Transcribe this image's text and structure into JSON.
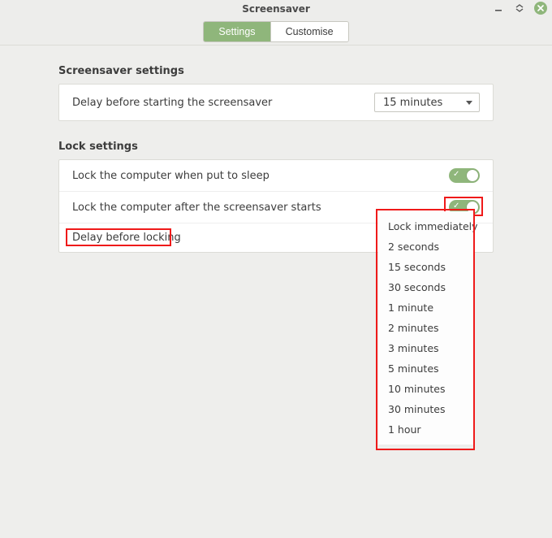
{
  "window": {
    "title": "Screensaver"
  },
  "tabs": {
    "settings": "Settings",
    "customise": "Customise"
  },
  "sections": {
    "screensaver": {
      "title": "Screensaver settings",
      "rows": {
        "delay_start": {
          "label": "Delay before starting the screensaver",
          "value": "15 minutes"
        }
      }
    },
    "lock": {
      "title": "Lock settings",
      "rows": {
        "lock_sleep": {
          "label": "Lock the computer when put to sleep",
          "on": true
        },
        "lock_after_ss": {
          "label": "Lock the computer after the screensaver starts",
          "on": true
        },
        "delay_lock": {
          "label": "Delay before locking"
        }
      }
    }
  },
  "delay_menu": {
    "items": [
      "Lock immediately",
      "2 seconds",
      "15 seconds",
      "30 seconds",
      "1 minute",
      "2 minutes",
      "3 minutes",
      "5 minutes",
      "10 minutes",
      "30 minutes",
      "1 hour"
    ]
  }
}
